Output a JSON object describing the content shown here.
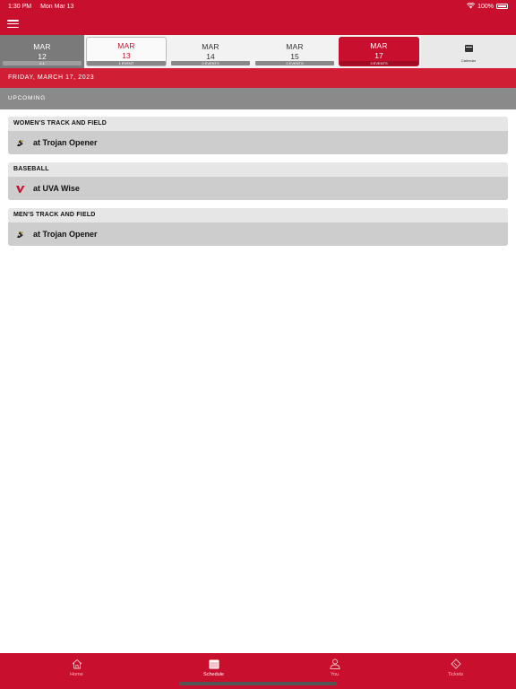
{
  "status": {
    "time": "1:30 PM",
    "date": "Mon Mar 13",
    "battery": "100%"
  },
  "date_strip": [
    {
      "month": "MAR",
      "day": "12",
      "count": "0-1"
    },
    {
      "month": "MAR",
      "day": "13",
      "count": "1 EVENT"
    },
    {
      "month": "MAR",
      "day": "14",
      "count": "0 EVENTS"
    },
    {
      "month": "MAR",
      "day": "15",
      "count": "2 EVENTS"
    },
    {
      "month": "MAR",
      "day": "17",
      "count": "3 EVENTS"
    }
  ],
  "calendar_label": "Calendar",
  "date_banner": "FRIDAY, MARCH 17, 2023",
  "section_header": "UPCOMING",
  "events": [
    {
      "sport": "WOMEN'S TRACK AND FIELD",
      "title": "at Trojan Opener",
      "logo": "trojan-logo-icon"
    },
    {
      "sport": "BASEBALL",
      "title": "at UVA Wise",
      "logo": "uva-wise-logo-icon"
    },
    {
      "sport": "MEN'S TRACK AND FIELD",
      "title": "at Trojan Opener",
      "logo": "trojan-logo-icon"
    }
  ],
  "tabs": [
    {
      "label": "Home",
      "icon": "home-icon"
    },
    {
      "label": "Schedule",
      "icon": "calendar-icon"
    },
    {
      "label": "You",
      "icon": "person-icon"
    },
    {
      "label": "Tickets",
      "icon": "ticket-icon"
    }
  ],
  "colors": {
    "brand": "#c8102e",
    "banner": "#d01f34",
    "section": "#8a8a8a"
  }
}
